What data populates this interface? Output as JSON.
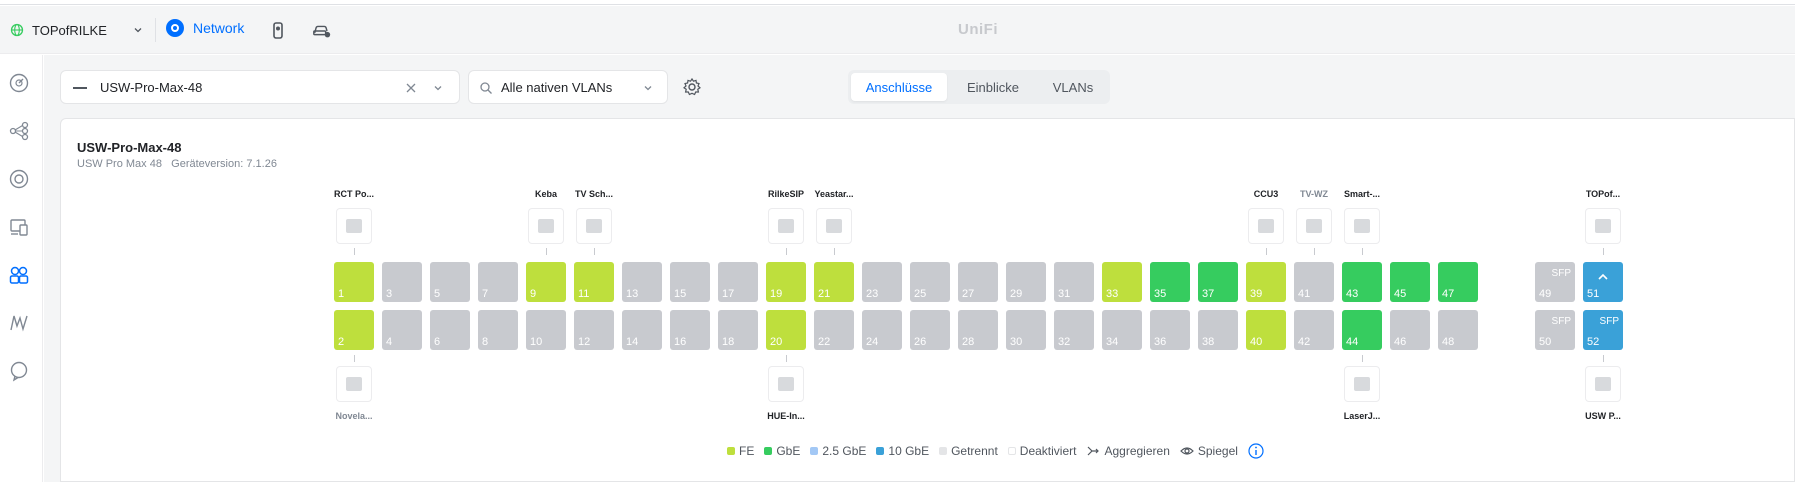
{
  "topbar": {
    "site_name": "TOPofRILKE",
    "app_name": "Network",
    "logo": "UniFi",
    "icons": [
      "globe-icon",
      "chevron-down-icon",
      "network-icon",
      "protect-icon",
      "connect-icon"
    ]
  },
  "sidebar": {
    "icons": [
      "dashboard-icon",
      "topology-icon",
      "devices-icon",
      "clients-icon",
      "ports-icon",
      "insights-icon",
      "settings-icon"
    ],
    "active_index": 4
  },
  "toolbar": {
    "device_name": "USW-Pro-Max-48",
    "vlan_filter": "Alle nativen VLANs",
    "tabs": [
      "Anschlüsse",
      "Einblicke",
      "VLANs"
    ],
    "active_tab": "Anschlüsse"
  },
  "device": {
    "title": "USW-Pro-Max-48",
    "model": "USW Pro Max 48",
    "version_label": "Geräteversion:",
    "version": "7.1.26"
  },
  "colors": {
    "fe": "#bedf3d",
    "gbe": "#36cc5f",
    "25gbe": "#a3c8f5",
    "10gbe": "#3aa1d8",
    "disconnected": "#e4e5e7",
    "disabled": "#ffffff",
    "accent": "#006fff"
  },
  "ports_top": [
    {
      "num": "1",
      "speed": "fe",
      "label": "RCT Po..."
    },
    {
      "num": "3",
      "speed": "off"
    },
    {
      "num": "5",
      "speed": "off"
    },
    {
      "num": "7",
      "speed": "off"
    },
    {
      "num": "9",
      "speed": "fe",
      "label": "Keba"
    },
    {
      "num": "11",
      "speed": "fe",
      "label": "TV Sch..."
    },
    {
      "num": "13",
      "speed": "off"
    },
    {
      "num": "15",
      "speed": "off"
    },
    {
      "num": "17",
      "speed": "off"
    },
    {
      "num": "19",
      "speed": "fe",
      "label": "RilkeSIP"
    },
    {
      "num": "21",
      "speed": "fe",
      "label": "Yeastar..."
    },
    {
      "num": "23",
      "speed": "off"
    },
    {
      "num": "25",
      "speed": "off"
    },
    {
      "num": "27",
      "speed": "off"
    },
    {
      "num": "29",
      "speed": "off"
    },
    {
      "num": "31",
      "speed": "off"
    },
    {
      "num": "33",
      "speed": "fe"
    },
    {
      "num": "35",
      "speed": "gbe"
    },
    {
      "num": "37",
      "speed": "gbe"
    },
    {
      "num": "39",
      "speed": "fe",
      "label": "CCU3"
    },
    {
      "num": "41",
      "speed": "off",
      "label": "TV-WZ"
    },
    {
      "num": "43",
      "speed": "gbe",
      "label": "Smart-..."
    },
    {
      "num": "45",
      "speed": "gbe"
    },
    {
      "num": "47",
      "speed": "gbe"
    }
  ],
  "ports_bottom": [
    {
      "num": "2",
      "speed": "fe",
      "label": "Novela..."
    },
    {
      "num": "4",
      "speed": "off"
    },
    {
      "num": "6",
      "speed": "off"
    },
    {
      "num": "8",
      "speed": "off"
    },
    {
      "num": "10",
      "speed": "off"
    },
    {
      "num": "12",
      "speed": "off"
    },
    {
      "num": "14",
      "speed": "off"
    },
    {
      "num": "16",
      "speed": "off"
    },
    {
      "num": "18",
      "speed": "off"
    },
    {
      "num": "20",
      "speed": "fe",
      "label": "HUE-In..."
    },
    {
      "num": "22",
      "speed": "off"
    },
    {
      "num": "24",
      "speed": "off"
    },
    {
      "num": "26",
      "speed": "off"
    },
    {
      "num": "28",
      "speed": "off"
    },
    {
      "num": "30",
      "speed": "off"
    },
    {
      "num": "32",
      "speed": "off"
    },
    {
      "num": "34",
      "speed": "off"
    },
    {
      "num": "36",
      "speed": "off"
    },
    {
      "num": "38",
      "speed": "off"
    },
    {
      "num": "40",
      "speed": "fe"
    },
    {
      "num": "42",
      "speed": "off"
    },
    {
      "num": "44",
      "speed": "gbe",
      "label": "LaserJ..."
    },
    {
      "num": "46",
      "speed": "off"
    },
    {
      "num": "48",
      "speed": "off"
    }
  ],
  "sfp_top": [
    {
      "num": "49",
      "speed": "off",
      "tag": "SFP"
    },
    {
      "num": "51",
      "speed": "ten",
      "label": "TOPof...",
      "uplink": true
    }
  ],
  "sfp_bottom": [
    {
      "num": "50",
      "speed": "off",
      "tag": "SFP"
    },
    {
      "num": "52",
      "speed": "ten",
      "tag": "SFP",
      "label": "USW P..."
    }
  ],
  "legend": {
    "fe": "FE",
    "gbe": "GbE",
    "25gbe": "2.5 GbE",
    "10gbe": "10 GbE",
    "disconnected": "Getrennt",
    "disabled": "Deaktiviert",
    "aggregate": "Aggregieren",
    "mirror": "Spiegel"
  }
}
